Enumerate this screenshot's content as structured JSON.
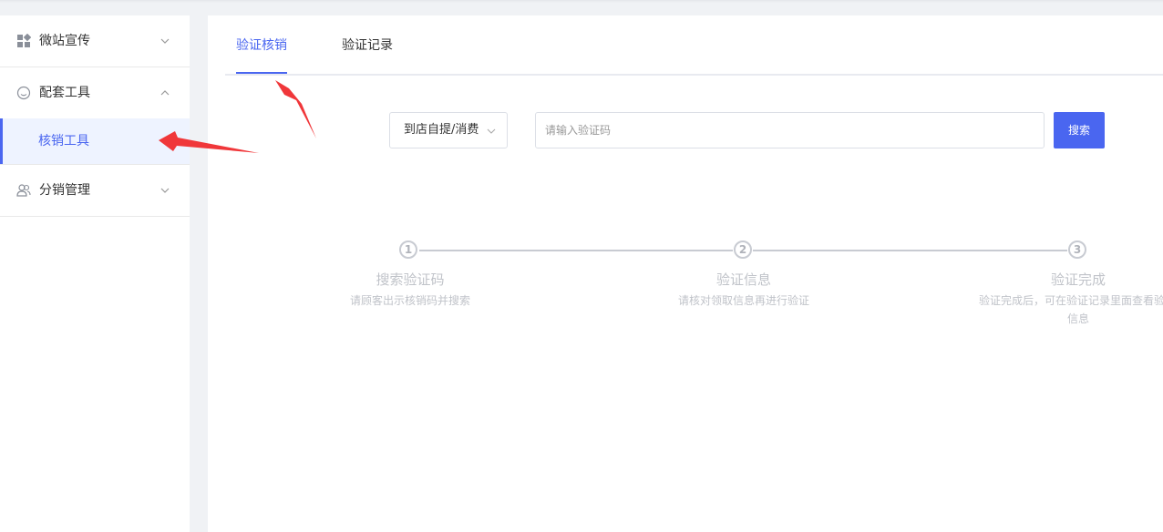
{
  "sidebar": {
    "groups": [
      {
        "label": "微站宣传",
        "icon": "grid-icon",
        "expanded": false
      },
      {
        "label": "配套工具",
        "icon": "smiley-icon",
        "expanded": true,
        "items": [
          {
            "label": "核销工具",
            "active": true
          }
        ]
      },
      {
        "label": "分销管理",
        "icon": "users-icon",
        "expanded": false
      }
    ]
  },
  "tabs": [
    {
      "label": "验证核销",
      "active": true
    },
    {
      "label": "验证记录",
      "active": false
    }
  ],
  "search": {
    "type_selected": "到店自提/消费",
    "placeholder": "请输入验证码",
    "button_label": "搜索"
  },
  "steps": [
    {
      "number": "1",
      "title": "搜索验证码",
      "desc": "请顾客出示核销码并搜索"
    },
    {
      "number": "2",
      "title": "验证信息",
      "desc": "请核对领取信息再进行验证"
    },
    {
      "number": "3",
      "title": "验证完成",
      "desc_line1": "验证完成后，可在验证记录里面查看验",
      "desc_line2": "信息"
    }
  ],
  "colors": {
    "accent": "#4a66f0",
    "annotation_arrow": "#f0373a",
    "step_gray": "#c0c3c9"
  }
}
